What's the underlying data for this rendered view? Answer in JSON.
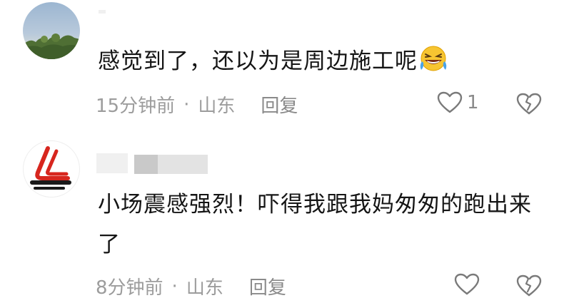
{
  "comments": [
    {
      "avatar": "landscape-avatar",
      "text": "感觉到了，还以为是周边施工呢",
      "emoji": "rolling-on-floor-laughing-emoji",
      "time": "15分钟前",
      "separator": "·",
      "location": "山东",
      "reply_label": "回复",
      "like_count": "1",
      "like_icon": "heart-outline-icon",
      "dislike_icon": "broken-heart-icon"
    },
    {
      "avatar": "logo-avatar",
      "text": "小场震感强烈！吓得我跟我妈匆匆的跑出来了",
      "time": "8分钟前",
      "separator": "·",
      "location": "山东",
      "reply_label": "回复",
      "like_icon": "heart-outline-icon",
      "dislike_icon": "broken-heart-icon"
    }
  ],
  "colors": {
    "text": "#151515",
    "meta": "#9c9c9c",
    "logo_red": "#d7261e",
    "logo_black": "#1a1a1a"
  }
}
